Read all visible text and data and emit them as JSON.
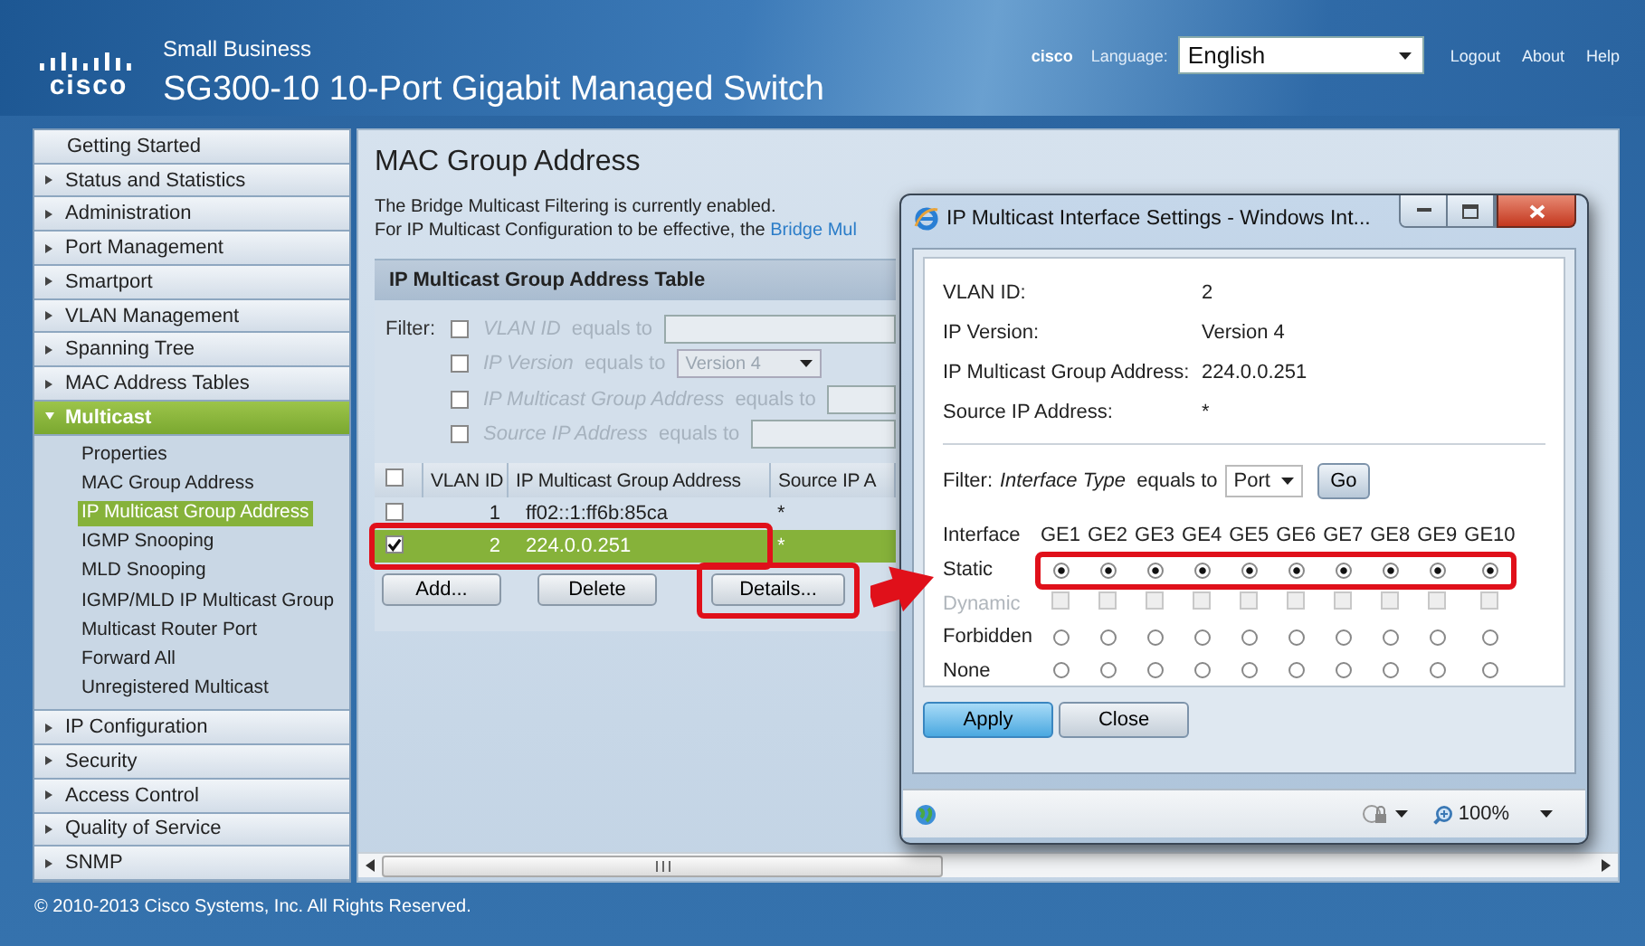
{
  "header": {
    "logo": "cisco",
    "brand_line": "Small Business",
    "title": "SG300-10 10-Port Gigabit Managed Switch",
    "vendor": "cisco",
    "language_label": "Language:",
    "language": "English",
    "links": [
      "Logout",
      "About",
      "Help"
    ]
  },
  "sidebar": {
    "items": [
      {
        "label": "Getting Started",
        "kind": "link"
      },
      {
        "label": "Status and Statistics",
        "kind": "folder",
        "expanded": false
      },
      {
        "label": "Administration",
        "kind": "folder",
        "expanded": false
      },
      {
        "label": "Port Management",
        "kind": "folder",
        "expanded": false
      },
      {
        "label": "Smartport",
        "kind": "folder",
        "expanded": false
      },
      {
        "label": "VLAN Management",
        "kind": "folder",
        "expanded": false
      },
      {
        "label": "Spanning Tree",
        "kind": "folder",
        "expanded": false
      },
      {
        "label": "MAC Address Tables",
        "kind": "folder",
        "expanded": false
      },
      {
        "label": "Multicast",
        "kind": "folder",
        "expanded": true,
        "children": [
          {
            "label": "Properties",
            "selected": false
          },
          {
            "label": "MAC Group Address",
            "selected": false
          },
          {
            "label": "IP Multicast Group Address",
            "selected": true
          },
          {
            "label": "IGMP Snooping",
            "selected": false
          },
          {
            "label": "MLD Snooping",
            "selected": false
          },
          {
            "label": "IGMP/MLD IP Multicast Group",
            "selected": false
          },
          {
            "label": "Multicast Router Port",
            "selected": false
          },
          {
            "label": "Forward All",
            "selected": false
          },
          {
            "label": "Unregistered Multicast",
            "selected": false
          }
        ]
      },
      {
        "label": "IP Configuration",
        "kind": "folder",
        "expanded": false
      },
      {
        "label": "Security",
        "kind": "folder",
        "expanded": false
      },
      {
        "label": "Access Control",
        "kind": "folder",
        "expanded": false
      },
      {
        "label": "Quality of Service",
        "kind": "folder",
        "expanded": false
      },
      {
        "label": "SNMP",
        "kind": "folder",
        "expanded": false
      }
    ]
  },
  "main": {
    "title": "MAC Group Address",
    "notice": "The Bridge Multicast Filtering is currently enabled.",
    "notice_2": "For IP Multicast Configuration to be effective, the ",
    "notice_link": "Bridge Mul"
  },
  "table": {
    "title": "IP Multicast Group Address Table",
    "filter_label": "Filter:",
    "filters": [
      {
        "checked": false,
        "field": "VLAN ID",
        "op": "equals to",
        "kind": "text"
      },
      {
        "checked": false,
        "field": "IP Version",
        "op": "equals to",
        "kind": "select",
        "value": "Version 4"
      },
      {
        "checked": false,
        "field": "IP Multicast Group Address",
        "op": "equals to",
        "kind": "text"
      },
      {
        "checked": false,
        "field": "Source IP Address",
        "op": "equals to",
        "kind": "text"
      }
    ],
    "all_checked": false,
    "columns": [
      "VLAN ID",
      "IP Multicast Group Address",
      "Source IP A"
    ],
    "rows": [
      {
        "selected": false,
        "cells": [
          "1",
          "ff02::1:ff6b:85ca",
          "*"
        ]
      },
      {
        "selected": true,
        "cells": [
          "2",
          "224.0.0.251",
          "*"
        ]
      }
    ],
    "buttons": [
      "Add...",
      "Delete",
      "Details..."
    ]
  },
  "popup": {
    "title": "IP Multicast Interface Settings - Windows Int...",
    "details": [
      {
        "label": "VLAN ID:",
        "value": "2"
      },
      {
        "label": "IP Version:",
        "value": "Version 4"
      },
      {
        "label": "IP Multicast Group Address:",
        "value": "224.0.0.251"
      },
      {
        "label": "Source IP Address:",
        "value": "*"
      }
    ],
    "filter": {
      "label": "Filter:",
      "field": "Interface Type",
      "op": "equals to",
      "value": "Port",
      "button": "Go"
    },
    "grid": {
      "corner": "Interface",
      "ports": [
        "GE1",
        "GE2",
        "GE3",
        "GE4",
        "GE5",
        "GE6",
        "GE7",
        "GE8",
        "GE9",
        "GE10"
      ],
      "rows": [
        {
          "label": "Static",
          "kind": "radio",
          "disabled": false,
          "cells": [
            {
              "checked": true
            },
            {
              "checked": true
            },
            {
              "checked": true
            },
            {
              "checked": true
            },
            {
              "checked": true
            },
            {
              "checked": true
            },
            {
              "checked": true
            },
            {
              "checked": true
            },
            {
              "checked": true
            },
            {
              "checked": true
            }
          ]
        },
        {
          "label": "Dynamic",
          "kind": "checkbox",
          "disabled": true,
          "cells": [
            {
              "checked": false
            },
            {
              "checked": false
            },
            {
              "checked": false
            },
            {
              "checked": false
            },
            {
              "checked": false
            },
            {
              "checked": false
            },
            {
              "checked": false
            },
            {
              "checked": false
            },
            {
              "checked": false
            },
            {
              "checked": false
            }
          ]
        },
        {
          "label": "Forbidden",
          "kind": "radio",
          "disabled": false,
          "cells": [
            {
              "checked": false
            },
            {
              "checked": false
            },
            {
              "checked": false
            },
            {
              "checked": false
            },
            {
              "checked": false
            },
            {
              "checked": false
            },
            {
              "checked": false
            },
            {
              "checked": false
            },
            {
              "checked": false
            },
            {
              "checked": false
            }
          ]
        },
        {
          "label": "None",
          "kind": "radio",
          "disabled": false,
          "cells": [
            {
              "checked": false
            },
            {
              "checked": false
            },
            {
              "checked": false
            },
            {
              "checked": false
            },
            {
              "checked": false
            },
            {
              "checked": false
            },
            {
              "checked": false
            },
            {
              "checked": false
            },
            {
              "checked": false
            },
            {
              "checked": false
            }
          ]
        }
      ]
    },
    "buttons": [
      {
        "label": "Apply",
        "primary": true
      },
      {
        "label": "Close",
        "primary": false
      }
    ],
    "zoom": "100%"
  },
  "footer": "© 2010-2013 Cisco Systems, Inc. All Rights Reserved."
}
